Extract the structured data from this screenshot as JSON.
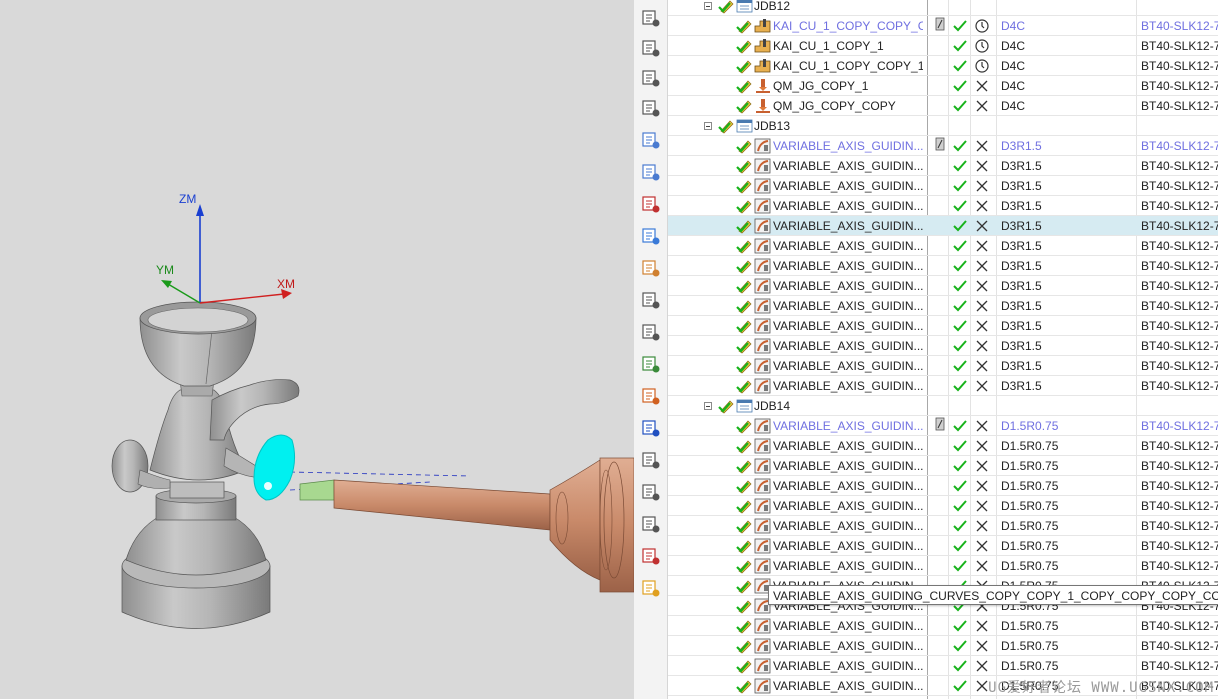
{
  "viewport": {
    "axes": {
      "z": "ZM",
      "y": "YM",
      "x": "XM"
    }
  },
  "toolbar": {
    "buttons": [
      {
        "name": "program-order-view-icon"
      },
      {
        "name": "machine-tool-view-icon"
      },
      {
        "name": "geometry-view-icon"
      },
      {
        "name": "method-view-icon"
      },
      {
        "name": "generate-toolpath-icon"
      },
      {
        "name": "verify-toolpath-icon"
      },
      {
        "name": "simulate-machine-icon"
      },
      {
        "name": "create-tool-icon"
      },
      {
        "name": "tool-library-icon"
      },
      {
        "name": "shop-documentation-icon"
      },
      {
        "name": "wrench-icon"
      },
      {
        "name": "copy-operation-icon"
      },
      {
        "name": "post-process-icon"
      },
      {
        "name": "list-sort-icon"
      },
      {
        "name": "funnel-filter-icon"
      },
      {
        "name": "table-report-icon"
      },
      {
        "name": "tool-setup-icon"
      },
      {
        "name": "move-axes-icon"
      },
      {
        "name": "transform-icon"
      }
    ]
  },
  "nav": {
    "rows": [
      {
        "type": "group",
        "name": "JDB12",
        "partial": true
      },
      {
        "type": "op",
        "kind": "cavity",
        "name": "KAI_CU_1_COPY_COPY_C...",
        "tool": "D4C",
        "holder": "BT40-SLK12-7",
        "active": true,
        "path_ok": true,
        "gen": "clock"
      },
      {
        "type": "op",
        "kind": "cavity",
        "name": "KAI_CU_1_COPY_1",
        "tool": "D4C",
        "holder": "BT40-SLK12-7",
        "gen": "clock"
      },
      {
        "type": "op",
        "kind": "cavity",
        "name": "KAI_CU_1_COPY_COPY_1",
        "tool": "D4C",
        "holder": "BT40-SLK12-7",
        "gen": "clock"
      },
      {
        "type": "op",
        "kind": "finish",
        "name": "QM_JG_COPY_1",
        "tool": "D4C",
        "holder": "BT40-SLK12-7",
        "gen": "x"
      },
      {
        "type": "op",
        "kind": "finish",
        "name": "QM_JG_COPY_COPY",
        "tool": "D4C",
        "holder": "BT40-SLK12-7",
        "gen": "x"
      },
      {
        "type": "group",
        "name": "JDB13"
      },
      {
        "type": "op",
        "kind": "vac",
        "name": "VARIABLE_AXIS_GUIDIN...",
        "tool": "D3R1.5",
        "holder": "BT40-SLK12-7",
        "active": true,
        "path_ok": true,
        "gen": "x"
      },
      {
        "type": "op",
        "kind": "vac",
        "name": "VARIABLE_AXIS_GUIDIN...",
        "tool": "D3R1.5",
        "holder": "BT40-SLK12-7",
        "gen": "x"
      },
      {
        "type": "op",
        "kind": "vac",
        "name": "VARIABLE_AXIS_GUIDIN...",
        "tool": "D3R1.5",
        "holder": "BT40-SLK12-7",
        "gen": "x"
      },
      {
        "type": "op",
        "kind": "vac",
        "name": "VARIABLE_AXIS_GUIDIN...",
        "tool": "D3R1.5",
        "holder": "BT40-SLK12-7",
        "gen": "x"
      },
      {
        "type": "op",
        "kind": "vac",
        "name": "VARIABLE_AXIS_GUIDIN...",
        "tool": "D3R1.5",
        "holder": "BT40-SLK12-7",
        "gen": "x",
        "selected": true
      },
      {
        "type": "op",
        "kind": "vac",
        "name": "VARIABLE_AXIS_GUIDIN...",
        "tool": "D3R1.5",
        "holder": "BT40-SLK12-7",
        "gen": "x"
      },
      {
        "type": "op",
        "kind": "vac",
        "name": "VARIABLE_AXIS_GUIDIN...",
        "tool": "D3R1.5",
        "holder": "BT40-SLK12-7",
        "gen": "x"
      },
      {
        "type": "op",
        "kind": "vac",
        "name": "VARIABLE_AXIS_GUIDIN...",
        "tool": "D3R1.5",
        "holder": "BT40-SLK12-7",
        "gen": "x"
      },
      {
        "type": "op",
        "kind": "vac",
        "name": "VARIABLE_AXIS_GUIDIN...",
        "tool": "D3R1.5",
        "holder": "BT40-SLK12-7",
        "gen": "x"
      },
      {
        "type": "op",
        "kind": "vac",
        "name": "VARIABLE_AXIS_GUIDIN...",
        "tool": "D3R1.5",
        "holder": "BT40-SLK12-7",
        "gen": "x"
      },
      {
        "type": "op",
        "kind": "vac",
        "name": "VARIABLE_AXIS_GUIDIN...",
        "tool": "D3R1.5",
        "holder": "BT40-SLK12-7",
        "gen": "x"
      },
      {
        "type": "op",
        "kind": "vac",
        "name": "VARIABLE_AXIS_GUIDIN...",
        "tool": "D3R1.5",
        "holder": "BT40-SLK12-7",
        "gen": "x"
      },
      {
        "type": "op",
        "kind": "vac",
        "name": "VARIABLE_AXIS_GUIDIN...",
        "tool": "D3R1.5",
        "holder": "BT40-SLK12-7",
        "gen": "x"
      },
      {
        "type": "group",
        "name": "JDB14"
      },
      {
        "type": "op",
        "kind": "vac",
        "name": "VARIABLE_AXIS_GUIDIN...",
        "tool": "D1.5R0.75",
        "holder": "BT40-SLK12-7",
        "active": true,
        "path_ok": true,
        "gen": "x"
      },
      {
        "type": "op",
        "kind": "vac",
        "name": "VARIABLE_AXIS_GUIDIN...",
        "tool": "D1.5R0.75",
        "holder": "BT40-SLK12-7",
        "gen": "x"
      },
      {
        "type": "op",
        "kind": "vac",
        "name": "VARIABLE_AXIS_GUIDIN...",
        "tool": "D1.5R0.75",
        "holder": "BT40-SLK12-7",
        "gen": "x"
      },
      {
        "type": "op",
        "kind": "vac",
        "name": "VARIABLE_AXIS_GUIDIN...",
        "tool": "D1.5R0.75",
        "holder": "BT40-SLK12-7",
        "gen": "x"
      },
      {
        "type": "op",
        "kind": "vac",
        "name": "VARIABLE_AXIS_GUIDIN...",
        "tool": "D1.5R0.75",
        "holder": "BT40-SLK12-7",
        "gen": "x"
      },
      {
        "type": "op",
        "kind": "vac",
        "name": "VARIABLE_AXIS_GUIDIN...",
        "tool": "D1.5R0.75",
        "holder": "BT40-SLK12-7",
        "gen": "x"
      },
      {
        "type": "op",
        "kind": "vac",
        "name": "VARIABLE_AXIS_GUIDIN...",
        "tool": "D1.5R0.75",
        "holder": "BT40-SLK12-7",
        "gen": "x"
      },
      {
        "type": "op",
        "kind": "vac",
        "name": "VARIABLE_AXIS_GUIDIN...",
        "tool": "D1.5R0.75",
        "holder": "BT40-SLK12-7",
        "gen": "x"
      },
      {
        "type": "op",
        "kind": "vac",
        "name": "VARIABLE_AXIS_GUIDIN...",
        "tool": "D1.5R0.75",
        "holder": "BT40-SLK12-7",
        "gen": "x"
      },
      {
        "type": "op",
        "kind": "vac",
        "name": "VARIABLE_AXIS_GUIDIN...",
        "tool": "D1.5R0.75",
        "holder": "BT40-SLK12-7",
        "gen": "x"
      },
      {
        "type": "op",
        "kind": "vac",
        "name": "VARIABLE_AXIS_GUIDIN...",
        "tool": "D1.5R0.75",
        "holder": "BT40-SLK12-7",
        "gen": "x"
      },
      {
        "type": "op",
        "kind": "vac",
        "name": "VARIABLE_AXIS_GUIDIN...",
        "tool": "D1.5R0.75",
        "holder": "BT40-SLK12-7",
        "gen": "x"
      },
      {
        "type": "op",
        "kind": "vac",
        "name": "VARIABLE_AXIS_GUIDIN...",
        "tool": "D1.5R0.75",
        "holder": "BT40-SLK12-7",
        "gen": "x"
      },
      {
        "type": "op",
        "kind": "vac",
        "name": "VARIABLE_AXIS_GUIDIN...",
        "tool": "D1.5R0.75",
        "holder": "BT40-SLK12-7",
        "gen": "x"
      }
    ],
    "tooltip": "VARIABLE_AXIS_GUIDING_CURVES_COPY_COPY_1_COPY_COPY_COPY_COPY_C"
  },
  "watermark": "UG爱好者论坛 WWW.UGSNX.COM",
  "colors": {
    "check": "#18b31c",
    "active_text": "#6f6fe0",
    "highlight_row": "#d6ebf2",
    "tool_copper": "#c88d6e",
    "toolpath_cyan": "#00f0f0",
    "viewport_bg": "#d9d9d9"
  }
}
